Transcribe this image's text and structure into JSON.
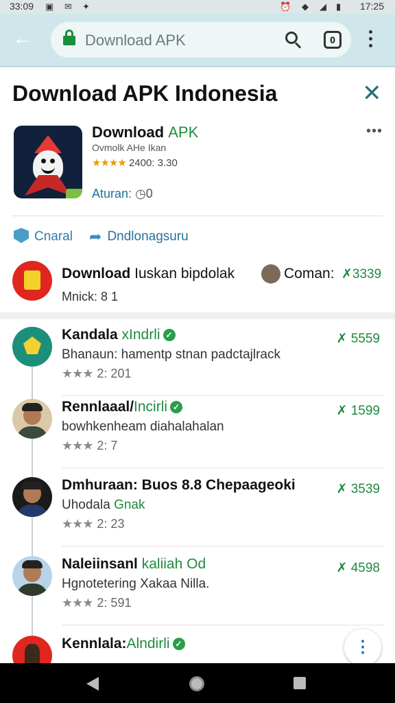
{
  "status_bar": {
    "time_left": "33:09",
    "time_right": "17:25"
  },
  "url_bar": {
    "url": "Download APK",
    "tabs_count": "0"
  },
  "page": {
    "title": "Download APK Indonesia"
  },
  "app": {
    "name": "Download",
    "name_accent": "APK",
    "developer": "Ovmolk AHe Ikan",
    "stars": "★★★★",
    "rating_text": "2400: 3.30",
    "rules_label": "Aturan:",
    "rules_value": "0",
    "more": "•••"
  },
  "actions": {
    "primary": "Cnaral",
    "secondary": "Dndlonagsuru"
  },
  "featured": {
    "title": "Download",
    "title_rest": "Iuskan bipdolak",
    "comment_label": "Coman:",
    "value": "3339",
    "sub": "Mnick: 8 1"
  },
  "items": [
    {
      "name": "Kandala",
      "name_accent": "xIndrli",
      "desc": "Bhanaun: hamentp stnan padctajlrack",
      "desc_accent": "",
      "stars": "★★★",
      "meta": "2: 201",
      "price": "5559"
    },
    {
      "name": "Rennlaaal/",
      "name_accent": "Incirli",
      "desc": "bowhkenheam diahalahalan",
      "desc_accent": "",
      "stars": "★★★",
      "meta": "2: 7",
      "price": "1599"
    },
    {
      "name": "Dmhuraan: Buos 8.8 Chepaageoki",
      "name_accent": "",
      "desc": "Uhodala",
      "desc_accent": "Gnak",
      "stars": "★★★",
      "meta": "2: 23",
      "price": "3539"
    },
    {
      "name": "Naleiinsanl",
      "name_accent": "kaliiah Od",
      "desc": "Hgnotetering Xakaa Nilla.",
      "desc_accent": "",
      "stars": "★★★",
      "meta": "2: 591",
      "price": "4598"
    },
    {
      "name": "Kennlala:",
      "name_accent": "Alndirli",
      "desc": "",
      "desc_accent": "",
      "stars": "",
      "meta": "",
      "price": ""
    }
  ],
  "price_prefix": "✗",
  "fab_icon": "⋮",
  "colors": {
    "accent_green": "#1f8a3d",
    "link_blue": "#2a7ea8",
    "toolbar": "#cfe7ea"
  }
}
